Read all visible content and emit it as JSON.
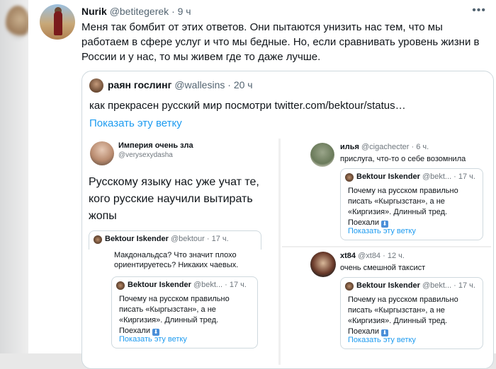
{
  "tweet": {
    "author_name": "Nurik",
    "author_handle": "@betitegerek",
    "separator": "·",
    "time": "9 ч",
    "more_icon": "more-dots-icon",
    "text": "Меня так бомбит от этих ответов. Они пытаются унизить нас тем, что мы работаем в сфере услуг и что мы бедные. Но, если сравнивать уровень жизни в России и у нас, то мы живем где то даже лучше."
  },
  "quote": {
    "author_name": "раян гослинг",
    "author_handle": "@wallesins",
    "separator": "·",
    "time": "20 ч",
    "text": "как прекрасен русский мир посмотри  twitter.com/bektour/status…",
    "show_thread": "Показать эту ветку"
  },
  "screenshot_left": {
    "name": "Империя очень зла",
    "handle": "@verysexydasha",
    "text": "Русскому языку нас уже учат те, кого русские научили вытирать жопы",
    "mini_quote_1": {
      "name": "Bektour Iskender",
      "handle": "@bektour",
      "sep": "·",
      "time": "17 ч."
    },
    "cut_text": "Макдональдса? Что значит плохо ориентируетесь? Никаких чаевых.",
    "mini_quote_2": {
      "name": "Bektour Iskender",
      "handle": "@bekt...",
      "sep": "·",
      "time": "17 ч.",
      "text": "Почему на русском правильно писать «Кыргызстан», а не «Киргизия». Длинный тред. Поехали",
      "emoji": "⬇",
      "link": "Показать эту ветку"
    }
  },
  "screenshot_right": {
    "post1": {
      "name": "илья",
      "handle": "@cigachecter",
      "sep": "·",
      "time": "6 ч.",
      "text": "прислуга, что-то о себе возомнила"
    },
    "mini_quote_1": {
      "name": "Bektour Iskender",
      "handle": "@bekt...",
      "sep": "·",
      "time": "17 ч.",
      "text": "Почему на русском правильно писать «Кыргызстан», а не «Киргизия». Длинный тред. Поехали",
      "emoji": "⬇",
      "link": "Показать эту ветку"
    },
    "post2": {
      "name": "xt84",
      "handle": "@xt84",
      "sep": "·",
      "time": "12 ч.",
      "text": "очень смешной таксист"
    },
    "mini_quote_2": {
      "name": "Bektour Iskender",
      "handle": "@bekt...",
      "sep": "·",
      "time": "17 ч.",
      "text": "Почему на русском правильно писать «Кыргызстан», а не «Киргизия». Длинный тред. Поехали",
      "emoji": "⬇",
      "link": "Показать эту ветку"
    }
  }
}
